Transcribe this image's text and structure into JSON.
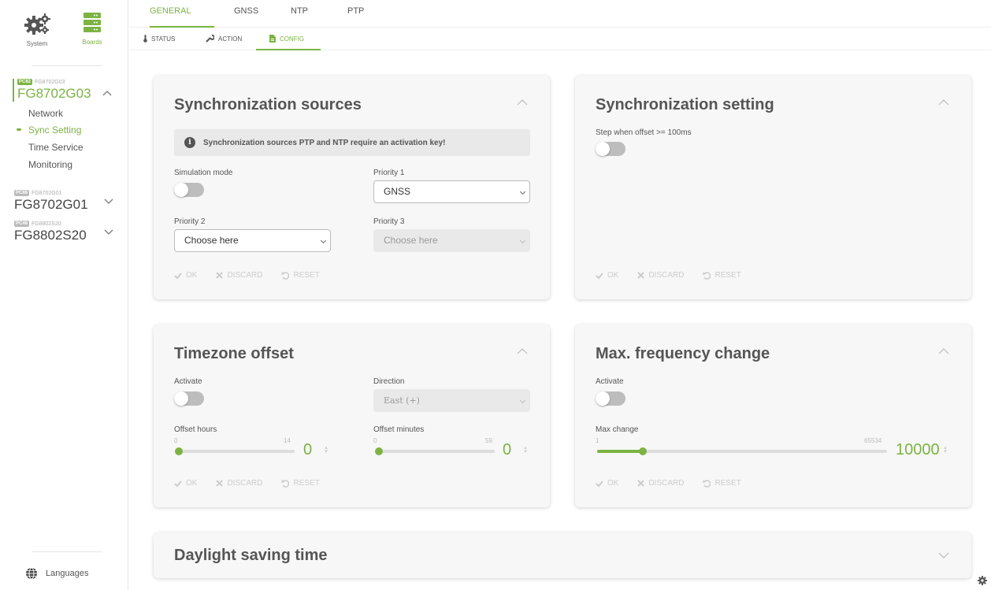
{
  "sidebar": {
    "system_label": "System",
    "boards_label": "Boards",
    "boards": [
      {
        "badge": "PC82",
        "small": "FG8702G03",
        "name": "FG8702G03"
      },
      {
        "badge": "PC88",
        "small": "FG8702G01",
        "name": "FG8702G01"
      },
      {
        "badge": "PC48",
        "small": "FG8802S20",
        "name": "FG8802S20"
      }
    ],
    "nav": [
      {
        "label": "Network"
      },
      {
        "label": "Sync Setting"
      },
      {
        "label": "Time Service"
      },
      {
        "label": "Monitoring"
      }
    ],
    "languages_label": "Languages"
  },
  "tabs": [
    "GENERAL",
    "GNSS",
    "NTP",
    "PTP"
  ],
  "subtabs": [
    "STATUS",
    "ACTION",
    "CONFIG"
  ],
  "sync_sources": {
    "title": "Synchronization sources",
    "info": "Synchronization sources PTP and NTP require an activation key!",
    "simulation_label": "Simulation mode",
    "priority1_label": "Priority 1",
    "priority1_value": "GNSS",
    "priority2_label": "Priority 2",
    "priority2_value": "Choose here",
    "priority3_label": "Priority 3",
    "priority3_value": "Choose here"
  },
  "actions": {
    "ok": "OK",
    "discard": "DISCARD",
    "reset": "RESET"
  },
  "sync_setting": {
    "title": "Synchronization setting",
    "step_label": "Step when offset >= 100ms"
  },
  "timezone": {
    "title": "Timezone offset",
    "activate_label": "Activate",
    "direction_label": "Direction",
    "direction_value": "East (+)",
    "hours_label": "Offset hours",
    "hours_min": "0",
    "hours_max": "14",
    "hours_value": "0",
    "minutes_label": "Offset minutes",
    "minutes_min": "0",
    "minutes_max": "59",
    "minutes_value": "0"
  },
  "freq": {
    "title": "Max. frequency change",
    "activate_label": "Activate",
    "max_label": "Max change",
    "min": "1",
    "max": "65534",
    "value": "10000"
  },
  "dst": {
    "title": "Daylight saving time"
  },
  "colors": {
    "accent": "#7cb342",
    "card_bg": "#f7f7f7"
  }
}
